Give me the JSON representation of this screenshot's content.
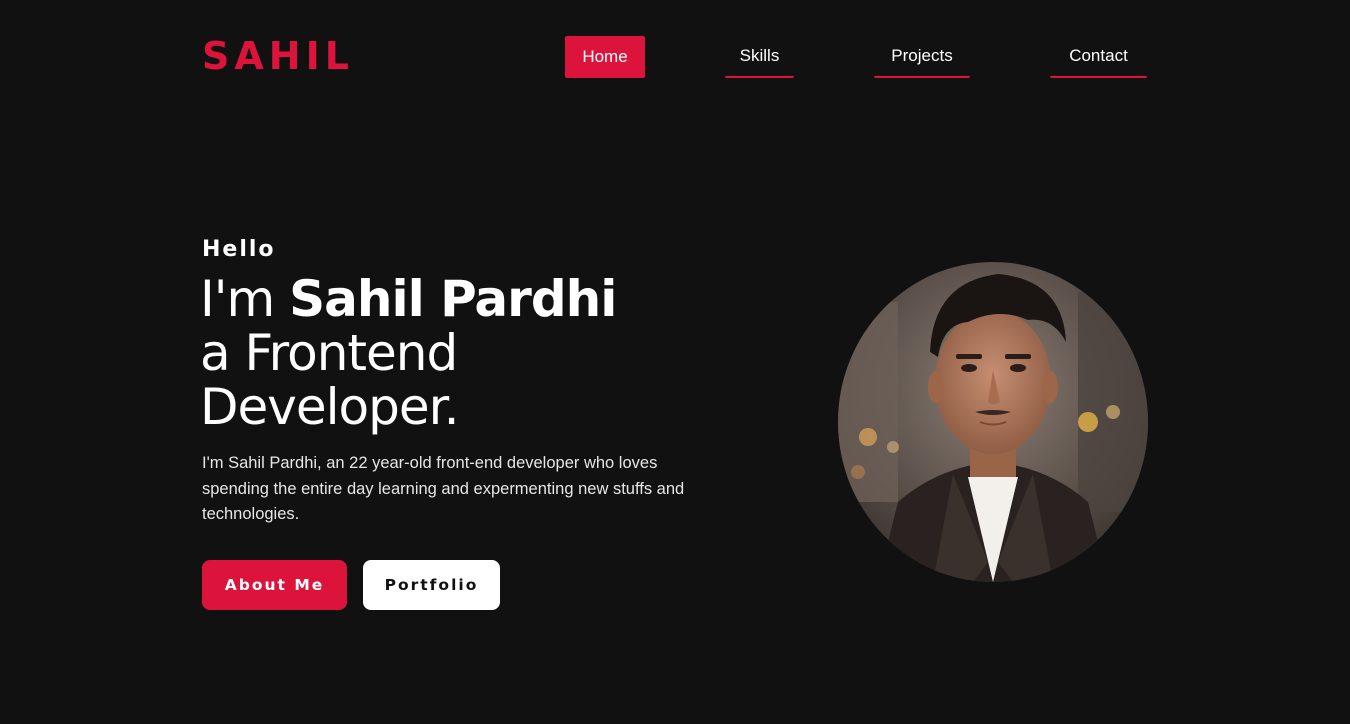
{
  "header": {
    "logo": "SAHIL",
    "nav": {
      "home": "Home",
      "skills": "Skills",
      "projects": "Projects",
      "contact": "Contact"
    },
    "active_item": "Home"
  },
  "hero": {
    "greeting": "Hello",
    "headline_prefix": "I'm ",
    "name": "Sahil Pardhi",
    "headline_line2": "a Frontend",
    "headline_line3": "Developer.",
    "intro": "I'm Sahil Pardhi, an 22 year-old front-end developer who loves spending the entire day learning and expermenting new stuffs and technologies.",
    "buttons": {
      "about": "About Me",
      "portfolio": "Portfolio"
    },
    "avatar_icon": "profile-photo"
  },
  "colors": {
    "background": "#111112",
    "accent": "#dc143c",
    "text": "#ffffff",
    "secondary_button": "#ffffff"
  }
}
